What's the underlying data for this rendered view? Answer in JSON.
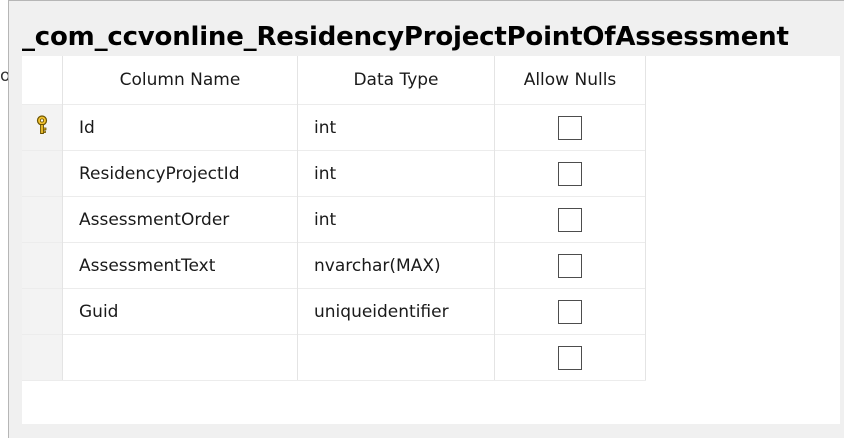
{
  "table": {
    "name": "_com_ccvonline_ResidencyProjectPointOfAssessment",
    "stub_letter": "o",
    "headers": {
      "column_name": "Column Name",
      "data_type": "Data Type",
      "allow_nulls": "Allow Nulls"
    },
    "rows": [
      {
        "name": "Id",
        "type": "int",
        "allow_nulls": false,
        "primary_key": true
      },
      {
        "name": "ResidencyProjectId",
        "type": "int",
        "allow_nulls": false,
        "primary_key": false
      },
      {
        "name": "AssessmentOrder",
        "type": "int",
        "allow_nulls": false,
        "primary_key": false
      },
      {
        "name": "AssessmentText",
        "type": "nvarchar(MAX)",
        "allow_nulls": false,
        "primary_key": false
      },
      {
        "name": "Guid",
        "type": "uniqueidentifier",
        "allow_nulls": false,
        "primary_key": false
      },
      {
        "name": "",
        "type": "",
        "allow_nulls": false,
        "primary_key": false
      }
    ],
    "key_icon": "primary-key-icon",
    "key_icon_color": "#e8b800"
  }
}
